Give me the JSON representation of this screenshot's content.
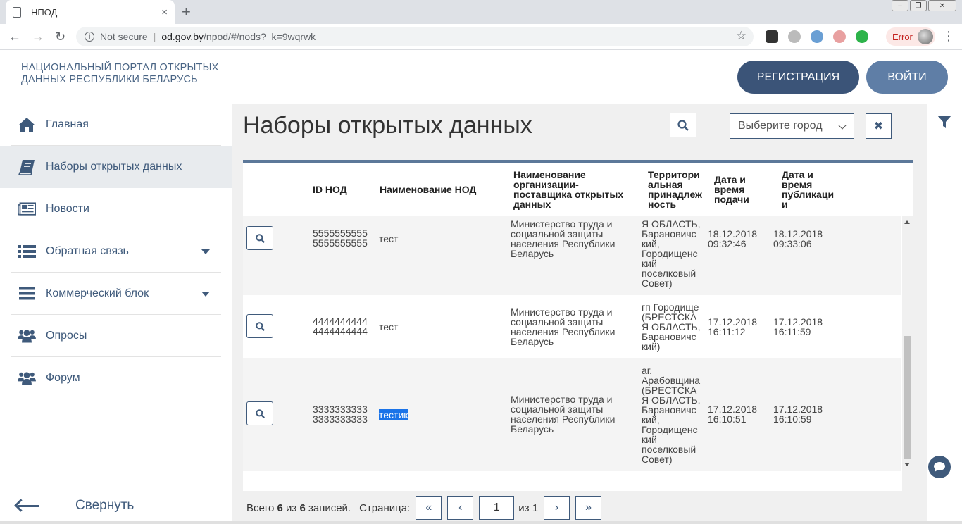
{
  "browser": {
    "tab_title": "НПОД",
    "tab_close": "×",
    "new_tab": "+",
    "security_label": "Not secure",
    "url_host": "od.gov.by",
    "url_path": "/npod/#/nods?_k=9wqrwk",
    "profile_status": "Error"
  },
  "header": {
    "portal_line1": "НАЦИОНАЛЬНЫЙ ПОРТАЛ ОТКРЫТЫХ",
    "portal_line2": "ДАННЫХ РЕСПУБЛИКИ БЕЛАРУСЬ",
    "register_label": "РЕГИСТРАЦИЯ",
    "login_label": "ВОЙТИ"
  },
  "sidebar": {
    "items": [
      {
        "label": "Главная"
      },
      {
        "label": "Наборы открытых данных"
      },
      {
        "label": "Новости"
      },
      {
        "label": "Обратная связь"
      },
      {
        "label": "Коммерческий блок"
      },
      {
        "label": "Опросы"
      },
      {
        "label": "Форум"
      }
    ],
    "collapse_label": "Свернуть"
  },
  "main": {
    "title": "Наборы открытых данных",
    "city_placeholder": "Выберите город",
    "columns": {
      "id": "ID НОД",
      "name": "Наименование НОД",
      "org": [
        "Наименование",
        "организации-",
        "поставщика открытых",
        "данных"
      ],
      "territory": [
        "Территори",
        "альная",
        "принадлеж",
        "ность"
      ],
      "submitted": [
        "Дата и",
        "время",
        "подачи"
      ],
      "published": [
        "Дата и",
        "время",
        "публикаци",
        "и"
      ]
    },
    "rows": [
      {
        "id": [
          "5555555555",
          "5555555555"
        ],
        "name": "тест",
        "org": [
          "Министерство труда и",
          "социальной защиты",
          "населения Республики",
          "Беларусь"
        ],
        "territory": [
          "Я ОБЛАСТЬ,",
          "Барановичс",
          "кий,",
          "Городищенс",
          "кий",
          "поселковый",
          "Совет)"
        ],
        "submitted": [
          "18.12.2018",
          "09:32:46"
        ],
        "published": [
          "18.12.2018",
          "09:33:06"
        ]
      },
      {
        "id": [
          "4444444444",
          "4444444444"
        ],
        "name": "тест",
        "org": [
          "Министерство труда и",
          "социальной защиты",
          "населения Республики",
          "Беларусь"
        ],
        "territory": [
          "гп Городище",
          "(БРЕСТСКА",
          "Я ОБЛАСТЬ,",
          "Барановичс",
          "кий)"
        ],
        "submitted": [
          "17.12.2018",
          "16:11:12"
        ],
        "published": [
          "17.12.2018",
          "16:11:59"
        ]
      },
      {
        "id": [
          "3333333333",
          "3333333333"
        ],
        "name": "тестик",
        "org": [
          "Министерство труда и",
          "социальной защиты",
          "населения Республики",
          "Беларусь"
        ],
        "territory": [
          "аг.",
          "Арабовщина",
          "(БРЕСТСКА",
          "Я ОБЛАСТЬ,",
          "Барановичс",
          "кий,",
          "Городищенс",
          "кий",
          "поселковый",
          "Совет)"
        ],
        "submitted": [
          "17.12.2018",
          "16:10:51"
        ],
        "published": [
          "17.12.2018",
          "16:10:59"
        ]
      }
    ],
    "pager": {
      "total_prefix": "Всего",
      "shown": "6",
      "of": "из",
      "total": "6",
      "records": "записей.",
      "page_label": "Страница:",
      "first": "«",
      "prev": "‹",
      "current": "1",
      "of_pages": "из 1",
      "next": "›",
      "last": "»"
    }
  },
  "colors": {
    "primary": "#3b5478",
    "accent": "#5f7ea6",
    "sidebar_text": "#3f5a7b",
    "selection": "#1a73e8"
  },
  "icons": {
    "home": "home-icon",
    "datasets": "book-icon",
    "news": "newspaper-icon",
    "feedback": "list-icon",
    "commerce": "menu-icon",
    "polls": "users-icon",
    "forum": "users-icon",
    "filter": "filter-icon",
    "chat": "chat-icon"
  }
}
